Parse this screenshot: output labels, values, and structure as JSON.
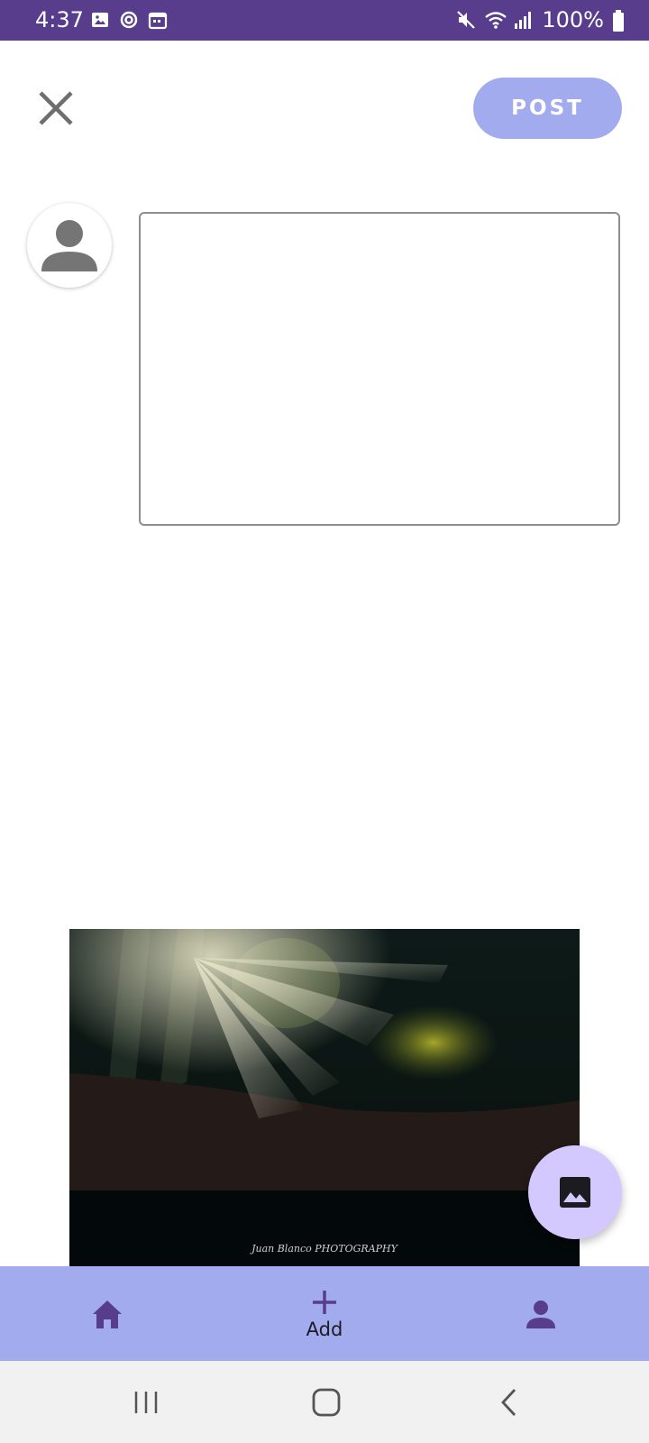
{
  "status_bar": {
    "time": "4:37",
    "battery_text": "100%",
    "left_icons": [
      "image-icon",
      "sync-icon",
      "calendar-icon"
    ],
    "right_icons": [
      "mute-icon",
      "wifi-icon",
      "signal-icon",
      "battery-icon"
    ],
    "background": "#573d8c"
  },
  "composer": {
    "close_icon": "close-icon",
    "post_label": "POST",
    "post_color": "#a3abef",
    "input_value": "",
    "input_placeholder": "",
    "avatar_icon": "person-icon"
  },
  "attachment": {
    "watermark_text": "Juan Blanco PHOTOGRAPHY"
  },
  "fab": {
    "icon": "image-icon",
    "color": "#d4c9ff"
  },
  "bottom_nav": {
    "background": "#a3abef",
    "items": [
      {
        "icon": "home-icon",
        "label": ""
      },
      {
        "icon": "add-icon",
        "label": "Add"
      },
      {
        "icon": "person-icon",
        "label": ""
      }
    ]
  },
  "system_nav": {
    "buttons": [
      "recents-icon",
      "home-button-icon",
      "back-icon"
    ]
  }
}
